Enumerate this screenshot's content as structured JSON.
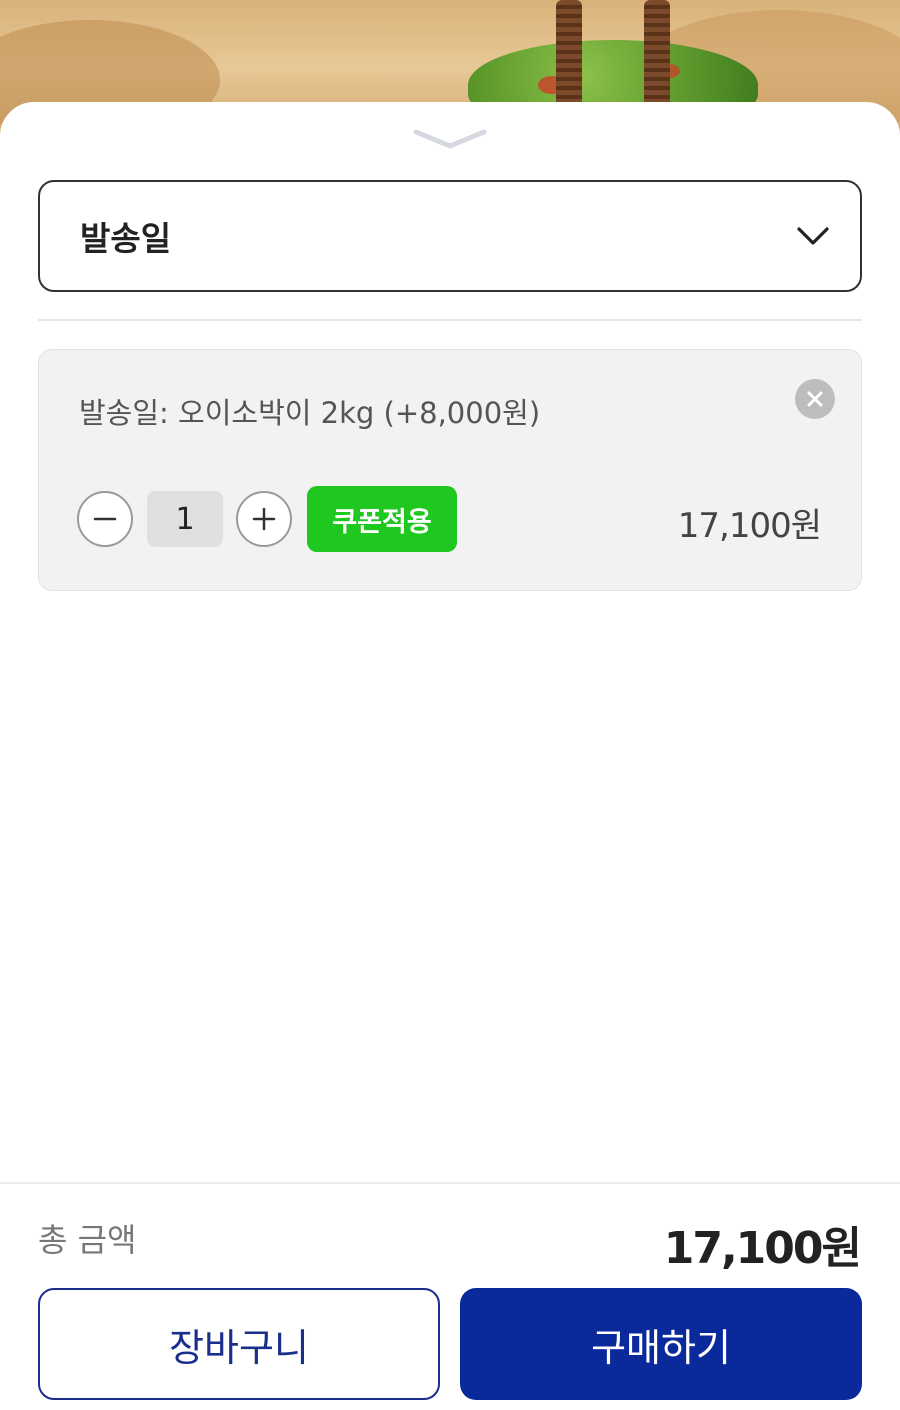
{
  "colors": {
    "coupon": "#1ec81e",
    "primary": "#0a2a9c",
    "outline_primary": "#1a2e8c"
  },
  "select": {
    "label": "발송일",
    "icon": "chevron-down-icon"
  },
  "option": {
    "text": "발송일: 오이소박이 2kg (+8,000원)",
    "quantity": "1",
    "coupon_label": "쿠폰적용",
    "price": "17,100원",
    "remove_icon": "close-icon",
    "minus_icon": "minus-icon",
    "plus_icon": "plus-icon"
  },
  "footer": {
    "total_label": "총 금액",
    "total_amount": "17,100원",
    "cart_label": "장바구니",
    "buy_label": "구매하기"
  }
}
